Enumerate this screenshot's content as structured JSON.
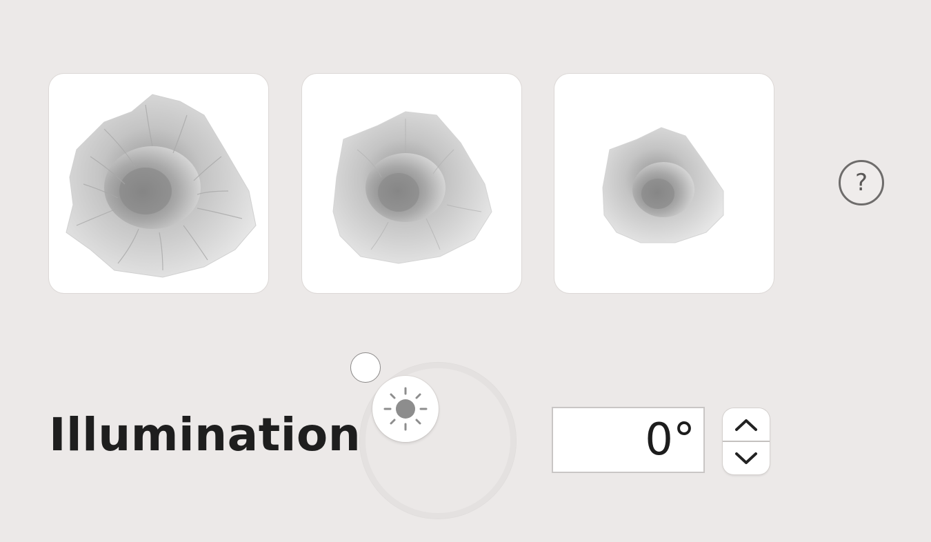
{
  "shading_presets": [
    {
      "icon": "terrain-shading-detailed"
    },
    {
      "icon": "terrain-shading-medium"
    },
    {
      "icon": "terrain-shading-low"
    }
  ],
  "help": {
    "label": "?"
  },
  "illumination": {
    "label": "Illumination",
    "value": "0°",
    "dial_icon": "sun-icon",
    "stepper": {
      "up_icon": "chevron-up-icon",
      "down_icon": "chevron-down-icon"
    }
  }
}
